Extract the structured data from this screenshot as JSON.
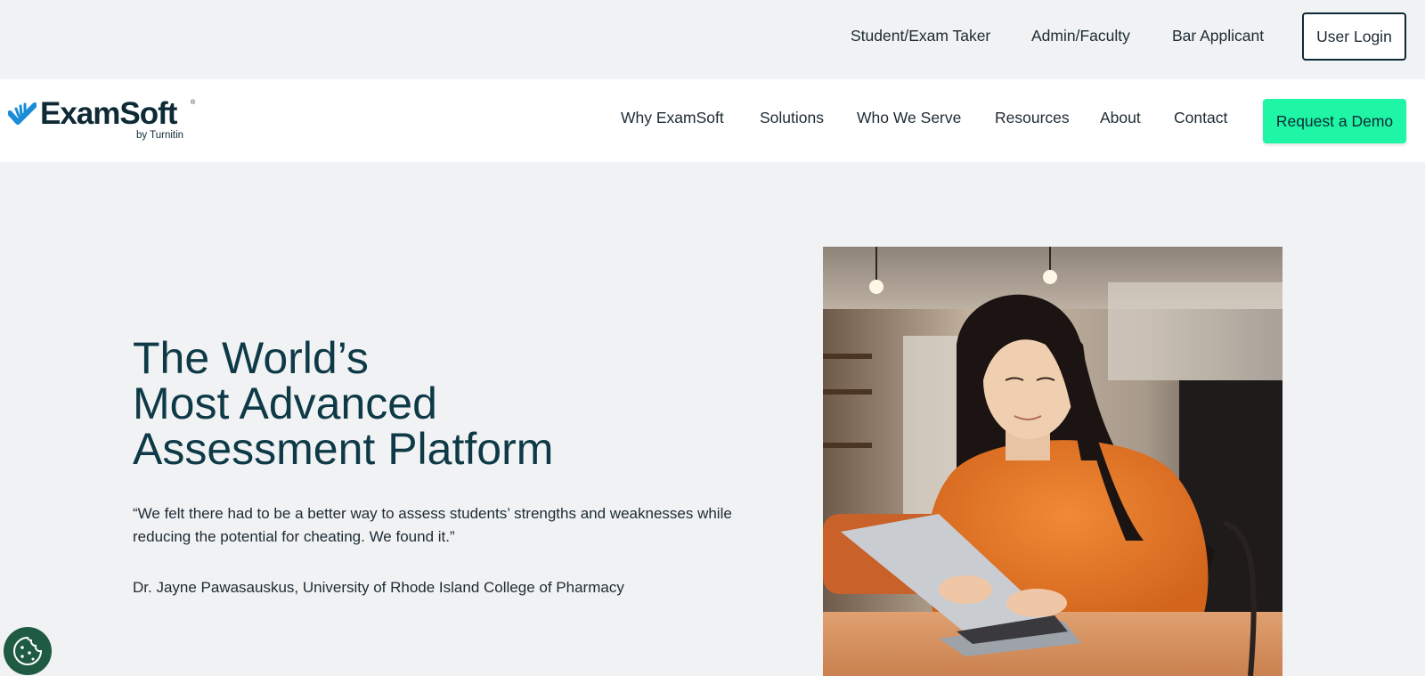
{
  "utility_nav": {
    "links": [
      {
        "label": "Student/Exam Taker"
      },
      {
        "label": "Admin/Faculty"
      },
      {
        "label": "Bar Applicant"
      }
    ],
    "login_label": "User Login"
  },
  "brand": {
    "name": "ExamSoft",
    "registered_mark": "®",
    "byline": "by Turnitin",
    "logo_icon": "check-hand-icon",
    "icon_color": "#1a8cd8"
  },
  "main_nav": {
    "items": [
      {
        "label": "Why ExamSoft"
      },
      {
        "label": "Solutions"
      },
      {
        "label": "Who We Serve"
      },
      {
        "label": "Resources"
      },
      {
        "label": "About"
      },
      {
        "label": "Contact"
      }
    ],
    "cta_label": "Request a Demo"
  },
  "hero": {
    "title_lines": [
      "The World’s",
      "Most Advanced",
      "Assessment Platform"
    ],
    "quote": "“We felt there had to be a better way to assess students’ strengths and weaknesses while reducing the potential for cheating. We found it.”",
    "author": "Dr. Jayne Pawasauskus, University of Rhode Island College of Pharmacy"
  },
  "cookie": {
    "icon": "cookie-icon"
  },
  "colors": {
    "page_bg": "#f1f2f4",
    "heading": "#0e3a47",
    "cta_bg": "#1ef5a5",
    "cookie_bg": "#1f5b43"
  }
}
